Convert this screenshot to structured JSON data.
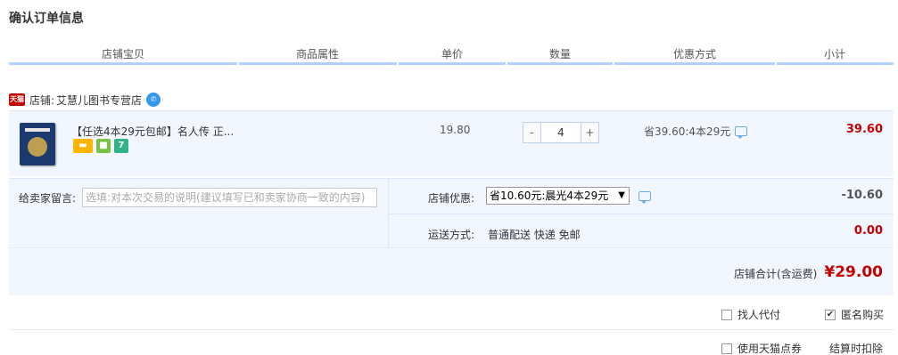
{
  "page_title": "确认订单信息",
  "columns": [
    "店铺宝贝",
    "商品属性",
    "单价",
    "数量",
    "优惠方式",
    "小计"
  ],
  "shop": {
    "badge": "天猫",
    "label": "店铺:",
    "name": "艾慧儿图书专营店"
  },
  "item": {
    "title": "【任选4本29元包邮】名人传 正...",
    "service_icons": [
      "card-icon",
      "gift-icon",
      "seven-day-return-icon"
    ],
    "seven_label": "7",
    "price": "19.80",
    "quantity": {
      "minus": "-",
      "value": "4",
      "plus": "+"
    },
    "promo": "省39.60:4本29元",
    "subtotal": "39.60"
  },
  "message": {
    "label": "给卖家留言:",
    "placeholder": "选填:对本次交易的说明(建议填写已和卖家协商一致的内容)"
  },
  "shop_discount": {
    "label": "店铺优惠:",
    "selected": "省10.60元:晨光4本29元",
    "arrow": "▼",
    "amount": "-10.60"
  },
  "shipping": {
    "label": "运送方式:",
    "value": "普通配送 快递 免邮",
    "amount": "0.00"
  },
  "total": {
    "label": "店铺合计(含运费)",
    "amount": "¥29.00"
  },
  "options": {
    "proxy_pay": {
      "label": "找人代付",
      "checked": false
    },
    "anonymous": {
      "label": "匿名购买",
      "checked": true,
      "mark": "✔"
    },
    "tmall_points": {
      "label": "使用天猫点券",
      "checked": false
    },
    "deduct_note": "结算时扣除"
  },
  "colors": {
    "accent_blue": "#b2d1ff",
    "panel_bg": "#f2f7ff",
    "price_red": "#c40000"
  }
}
